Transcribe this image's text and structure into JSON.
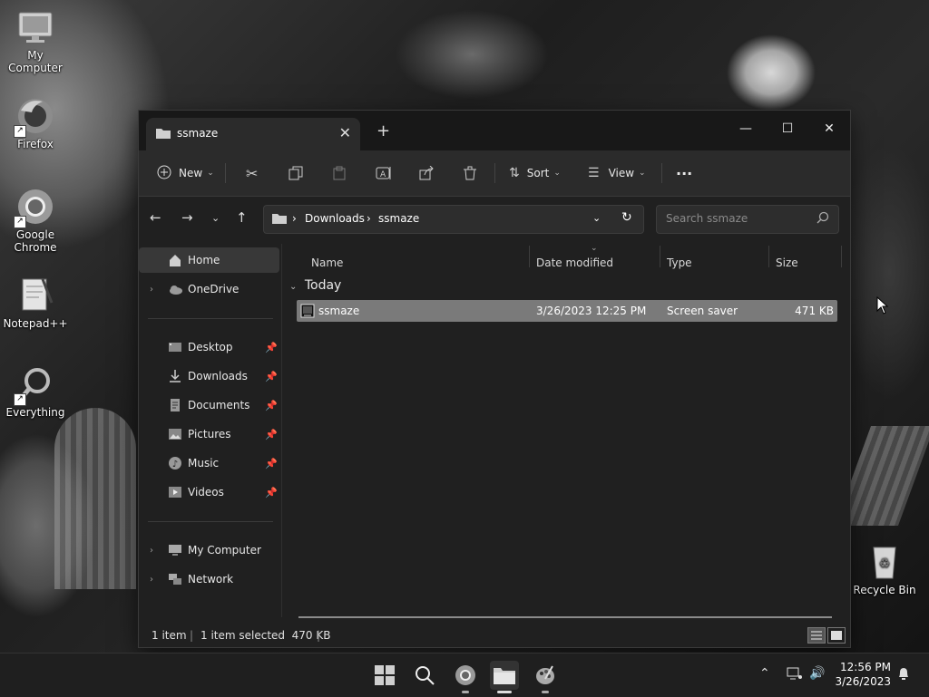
{
  "desktop": {
    "icons": [
      {
        "label": "My Computer",
        "icon": "monitor-icon"
      },
      {
        "label": "Firefox",
        "icon": "firefox-icon"
      },
      {
        "label": "Google Chrome",
        "icon": "chrome-icon"
      },
      {
        "label": "Notepad++",
        "icon": "notepadpp-icon"
      },
      {
        "label": "Everything",
        "icon": "everything-search-icon"
      },
      {
        "label": "Recycle Bin",
        "icon": "recycle-bin-icon"
      }
    ]
  },
  "window": {
    "tab_title": "ssmaze",
    "new_tab": "+",
    "controls": {
      "minimize": "—",
      "maximize": "☐",
      "close": "✕"
    },
    "toolbar": {
      "new_label": "New",
      "sort_label": "Sort",
      "view_label": "View",
      "more": "···"
    },
    "address": {
      "crumbs": [
        "Downloads",
        "ssmaze"
      ]
    },
    "search": {
      "placeholder": "Search ssmaze"
    },
    "sidebar": {
      "items": [
        {
          "label": "Home",
          "icon": "home-icon",
          "selected": true
        },
        {
          "label": "OneDrive",
          "icon": "cloud-icon"
        },
        {
          "label": "Desktop",
          "icon": "desktop-icon",
          "pinned": true
        },
        {
          "label": "Downloads",
          "icon": "download-icon",
          "pinned": true
        },
        {
          "label": "Documents",
          "icon": "document-icon",
          "pinned": true
        },
        {
          "label": "Pictures",
          "icon": "picture-icon",
          "pinned": true
        },
        {
          "label": "Music",
          "icon": "music-icon",
          "pinned": true
        },
        {
          "label": "Videos",
          "icon": "video-icon",
          "pinned": true
        },
        {
          "label": "My Computer",
          "icon": "computer-icon"
        },
        {
          "label": "Network",
          "icon": "network-icon"
        }
      ]
    },
    "columns": [
      "Name",
      "Date modified",
      "Type",
      "Size"
    ],
    "group": "Today",
    "files": [
      {
        "name": "ssmaze",
        "date": "3/26/2023 12:25 PM",
        "type": "Screen saver",
        "size": "471 KB",
        "selected": true
      }
    ],
    "status": {
      "count": "1 item",
      "selection": "1 item selected  470 KB"
    }
  },
  "taskbar": {
    "clock_time": "12:56 PM",
    "clock_date": "3/26/2023"
  },
  "colors": {
    "accent_selected_row": "#7a7a7a",
    "window_bg": "#202020",
    "toolbar_bg": "#2b2b2b"
  }
}
